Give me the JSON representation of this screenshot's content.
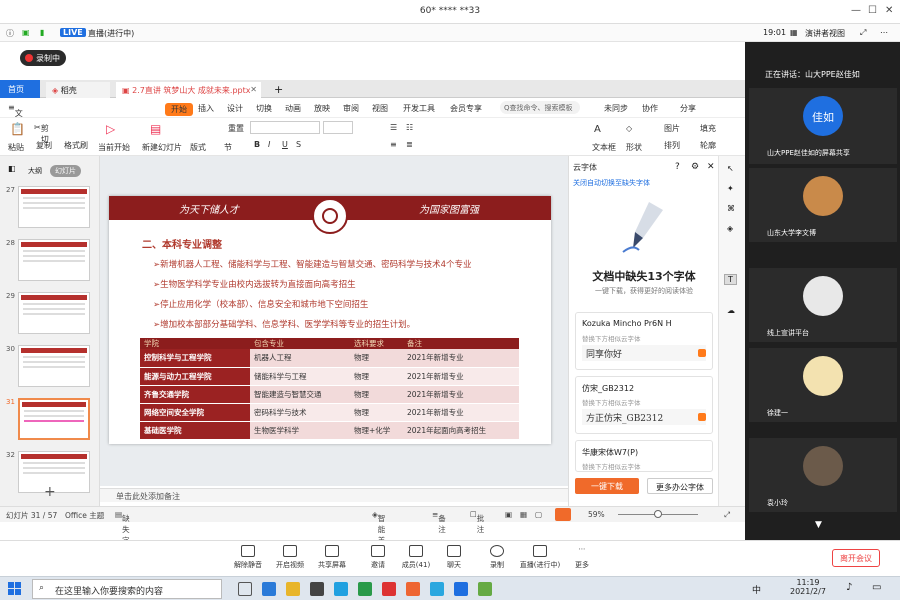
{
  "window": {
    "title": "60* **** **33"
  },
  "meeting": {
    "live": "LIVE",
    "status": "直播(进行中)",
    "timer": "19:01",
    "view": "演讲者视图",
    "recording": "录制中"
  },
  "tabs": {
    "home": "首页",
    "draft": "稻壳",
    "doc": "2.7直讲 筑梦山大 成就未来.pptx"
  },
  "menu": {
    "file": "文件",
    "start": "开始",
    "items": [
      "插入",
      "设计",
      "切换",
      "动画",
      "放映",
      "审阅",
      "视图",
      "开发工具",
      "会员专享"
    ],
    "search": "Q查找命令、搜索模板",
    "sync": "未同步",
    "collab": "协作",
    "share": "分享"
  },
  "ribbon": {
    "paste": "粘贴",
    "cut": "剪切",
    "copy": "复制",
    "format": "格式刷",
    "from_current": "当前开始",
    "new_slide": "新建幻灯片",
    "layout": "版式",
    "section": "节",
    "reset": "重置",
    "textbox": "文本框",
    "shape": "形状",
    "arrange": "排列",
    "picture": "图片",
    "fill": "填充",
    "outline": "轮廓"
  },
  "thumbs": {
    "view_outline": "大纲",
    "view_slides": "幻灯片",
    "numbers": [
      "27",
      "28",
      "29",
      "30",
      "31",
      "32"
    ]
  },
  "slide": {
    "header_left": "为天下储人才",
    "header_right": "为国家图富强",
    "title": "二、本科专业调整",
    "bullets": [
      "➢新增机器人工程、储能科学与工程、智能建造与智慧交通、密码科学与技术4个专业",
      "➢生物医学科学专业由校内选拔转为直接面向高考招生",
      "➢停止应用化学（校本部）、信息安全和城市地下空间招生",
      "➢增加校本部部分基础学科、信息学科、医学学科等专业的招生计划。"
    ],
    "table": {
      "headers": [
        "学院",
        "包含专业",
        "选科要求",
        "备注"
      ],
      "rows": [
        [
          "控制科学与工程学院",
          "机器人工程",
          "物理",
          "2021年新增专业"
        ],
        [
          "能源与动力工程学院",
          "储能科学与工程",
          "物理",
          "2021年新增专业"
        ],
        [
          "齐鲁交通学院",
          "智能建造与智慧交通",
          "物理",
          "2021年新增专业"
        ],
        [
          "网络空间安全学院",
          "密码科学与技术",
          "物理",
          "2021年新增专业"
        ],
        [
          "基础医学院",
          "生物医学科学",
          "物理+化学",
          "2021年起面向高考招生"
        ]
      ]
    }
  },
  "notes": "单击此处添加备注",
  "fontpane": {
    "title": "云字体",
    "subtitle": "关闭自动切换至缺失字体",
    "missing": "文档中缺失13个字体",
    "desc": "一键下载，获得更好的阅读体验",
    "fonts": [
      {
        "name": "Kozuka Mincho Pr6N H",
        "hint": "替换下方相似云字体",
        "sample": "同享你好"
      },
      {
        "name": "仿宋_GB2312",
        "hint": "替换下方相似云字体",
        "sample": "方正仿宋_GB2312"
      },
      {
        "name": "华康宋体W7(P)",
        "hint": "替换下方相似云字体",
        "sample": ""
      }
    ],
    "download": "一键下载",
    "more": "更多办公字体"
  },
  "status": {
    "slide": "幻灯片 31 / 57",
    "theme": "Office 主题",
    "missing_font": "缺失字体",
    "beautify": "智能美化",
    "notes": "备注",
    "comment": "批注",
    "zoom": "59%"
  },
  "participants": {
    "speaking": "正在讲话：山大PPE赵佳如",
    "tiles": [
      {
        "name": "山大PPE赵佳如的屏幕共享",
        "avatar": "佳如"
      },
      {
        "name": "山东大学李文博",
        "avatar": ""
      },
      {
        "name": "线上宣讲平台",
        "avatar": ""
      },
      {
        "name": "徐建一",
        "avatar": ""
      },
      {
        "name": "袁小玲",
        "avatar": ""
      }
    ]
  },
  "controls": {
    "items": [
      "解除静音",
      "开启视频",
      "共享屏幕",
      "邀请",
      "成员(41)",
      "聊天",
      "录制",
      "直播(进行中)",
      "更多"
    ],
    "leave": "离开会议"
  },
  "taskbar": {
    "search": "在这里输入你要搜索的内容",
    "time": "11:19",
    "date": "2021/2/7",
    "lang": "中"
  }
}
